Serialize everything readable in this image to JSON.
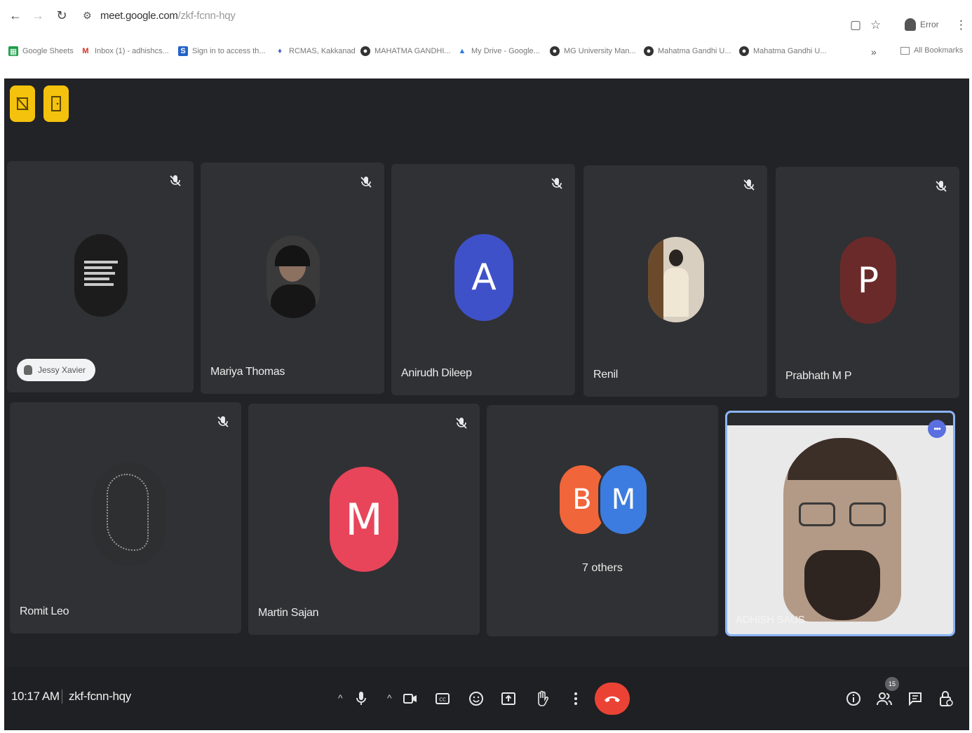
{
  "browser": {
    "url_host": "meet.google.com",
    "url_path": "/zkf-fcnn-hqy",
    "profile_label": "Error",
    "bookmarks": [
      {
        "label": "Google Sheets",
        "icon": "sheets-icon"
      },
      {
        "label": "Inbox (1) - adhishcs...",
        "icon": "gmail-icon"
      },
      {
        "label": "Sign in to access th...",
        "icon": "s-icon"
      },
      {
        "label": "RCMAS, Kakkanad",
        "icon": "rcmas-icon"
      },
      {
        "label": "MAHATMA GANDHI...",
        "icon": "globe-icon"
      },
      {
        "label": "My Drive - Google...",
        "icon": "drive-icon"
      },
      {
        "label": "MG University Man...",
        "icon": "globe-icon"
      },
      {
        "label": "Mahatma Gandhi U...",
        "icon": "globe-icon"
      },
      {
        "label": "Mahatma Gandhi U...",
        "icon": "globe-icon"
      }
    ],
    "more_bookmarks": "»",
    "all_bookmarks": "All Bookmarks"
  },
  "meet": {
    "participants_row1": [
      {
        "name": "Jessy Xavier",
        "type": "photo",
        "hand_raised": true
      },
      {
        "name": "Mariya Thomas",
        "type": "photo"
      },
      {
        "name": "Anirudh Dileep",
        "type": "initial",
        "initial": "A",
        "color": "#3f51c8"
      },
      {
        "name": "Renil",
        "type": "photo"
      },
      {
        "name": "Prabhath M P",
        "type": "initial",
        "initial": "P",
        "color": "#6b2a2a"
      }
    ],
    "participants_row2": [
      {
        "name": "Romit Leo",
        "type": "photo"
      },
      {
        "name": "Martin Sajan",
        "type": "initial",
        "initial": "M",
        "color": "#e8455a"
      }
    ],
    "others": {
      "label": "7 others",
      "initials": [
        {
          "initial": "B",
          "color": "#f0653a"
        },
        {
          "initial": "M",
          "color": "#3c7ce0"
        }
      ]
    },
    "self": {
      "name": "ADHISH SAUS"
    }
  },
  "bottom_bar": {
    "time": "10:17 AM",
    "meeting_code": "zkf-fcnn-hqy",
    "participant_count": "15"
  }
}
